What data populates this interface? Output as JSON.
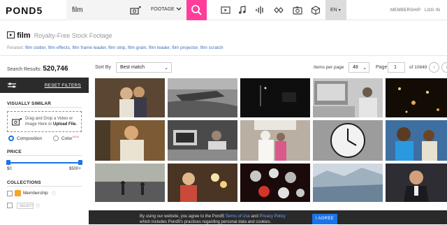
{
  "brand": {
    "logo_text": "POND5",
    "accent": "#ff3d9a"
  },
  "search": {
    "query": "film",
    "media_type": "FOOTAGE"
  },
  "nav": {
    "categories": [
      "video-icon",
      "music-icon",
      "sound-effects-icon",
      "after-effects-icon",
      "photo-icon",
      "3d-icon"
    ],
    "language": "EN",
    "membership": "MEMBERSHIP",
    "login": "LOG IN"
  },
  "page": {
    "title": "film",
    "subtitle": "Royalty-Free Stock Footage",
    "related_label": "Related:",
    "related": [
      "film clutter,",
      "film effects,",
      "film frame leader,",
      "film strip,",
      "film grain,",
      "film leader,",
      "film projector,",
      "film scratch"
    ]
  },
  "toolbar": {
    "results_label": "Search Results:",
    "results_count": "520,746",
    "sort_label": "Sort By",
    "sort_value": "Best match",
    "per_page_label": "Items per page",
    "per_page_value": "48",
    "page_label": "Page",
    "page_value": "1",
    "page_total": "of 10849"
  },
  "sidebar": {
    "reset_label": "RESET FILTERS",
    "visually_similar": "VISUALLY SIMILAR",
    "drop_line1": "Drag and Drop a Video or",
    "drop_line2a": "Image Here or ",
    "drop_line2b": "Upload File.",
    "composition": "Composition",
    "color": "Color",
    "color_badge": "NEW",
    "price": "PRICE",
    "price_min": "$0",
    "price_max": "$500+",
    "collections": "COLLECTIONS",
    "membership": "Membership",
    "select": "SELECT"
  },
  "cookie": {
    "line1a": "By using our website, you agree to the Pond5 ",
    "tos": "Terms of Use",
    "and": " and ",
    "privacy": "Privacy Policy",
    "line2": "which includes Pond5's practices regarding personal data and cookies.",
    "agree": "I AGREE"
  },
  "thumbnails": [
    {
      "desc": "couple-vintage",
      "color": "#8a6a4a"
    },
    {
      "desc": "boat-water",
      "color": "#6e6e6e"
    },
    {
      "desc": "dark-night",
      "color": "#151515"
    },
    {
      "desc": "office-computer",
      "color": "#b8b8b8"
    },
    {
      "desc": "sparkles-dark",
      "color": "#1a1208"
    },
    {
      "desc": "man-laughing",
      "color": "#a07a4c"
    },
    {
      "desc": "woman-computer",
      "color": "#555555"
    },
    {
      "desc": "family-crowd",
      "color": "#9a8c7a"
    },
    {
      "desc": "wall-clock",
      "color": "#a9a9a9"
    },
    {
      "desc": "kids-playing",
      "color": "#4a6a8a"
    },
    {
      "desc": "people-field",
      "color": "#3e3e3e"
    },
    {
      "desc": "girl-lights",
      "color": "#6a4a2a"
    },
    {
      "desc": "cells-red",
      "color": "#2a1010"
    },
    {
      "desc": "glacier",
      "color": "#9aa9b8"
    },
    {
      "desc": "politician",
      "color": "#6a6a72"
    }
  ]
}
